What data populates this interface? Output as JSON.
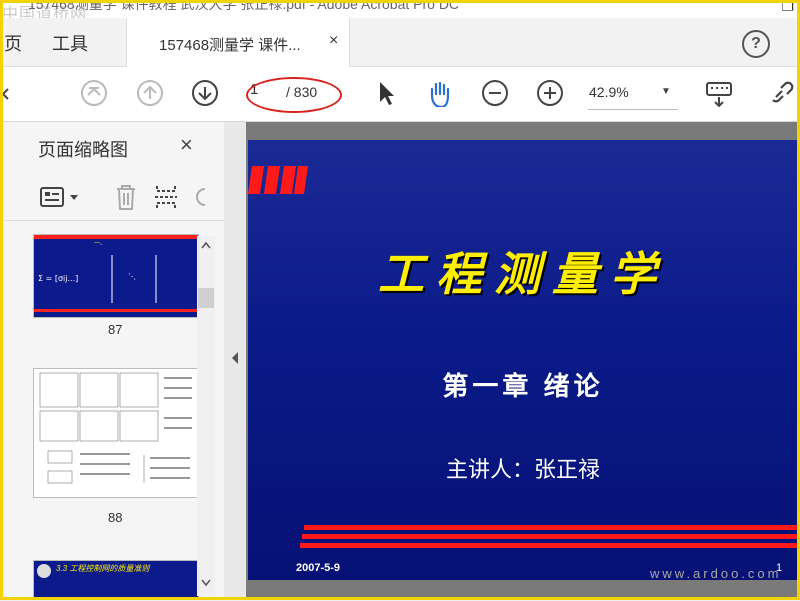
{
  "window": {
    "title": "157468测量学 课件教程 武汉大学 张正禄.pdf - Adobe Acrobat Pro DC",
    "watermark": "中国道桥网"
  },
  "menubar": {
    "items": [
      "页",
      "工具"
    ],
    "tab_label": "157468测量学 课件...",
    "tab_close": "×",
    "help": "?"
  },
  "toolbar": {
    "page_current": "1",
    "page_total": "/ 830",
    "zoom": "42.9%",
    "icons": [
      "first-page-icon",
      "prev-page-icon",
      "next-page-icon",
      "select-arrow-icon",
      "hand-tool-icon",
      "zoom-out-icon",
      "zoom-in-icon",
      "keyboard-icon",
      "link-icon"
    ]
  },
  "sidepanel": {
    "title": "页面缩略图",
    "close": "×",
    "thumbnails": [
      {
        "label": "87"
      },
      {
        "label": "88"
      }
    ],
    "thumb3_text": "3.3 工程控制网的质量准则"
  },
  "slide": {
    "title": "工程测量学",
    "chapter": "第一章   绪论",
    "lecturer": "主讲人：张正禄",
    "date": "2007-5-9",
    "page": "1"
  },
  "footer_watermark": "www.ardoo.com",
  "colors": {
    "slide_bg": "#0a1a88",
    "slide_title": "#ffee00",
    "accent_red": "#d8231e",
    "frame": "#f2d200"
  }
}
